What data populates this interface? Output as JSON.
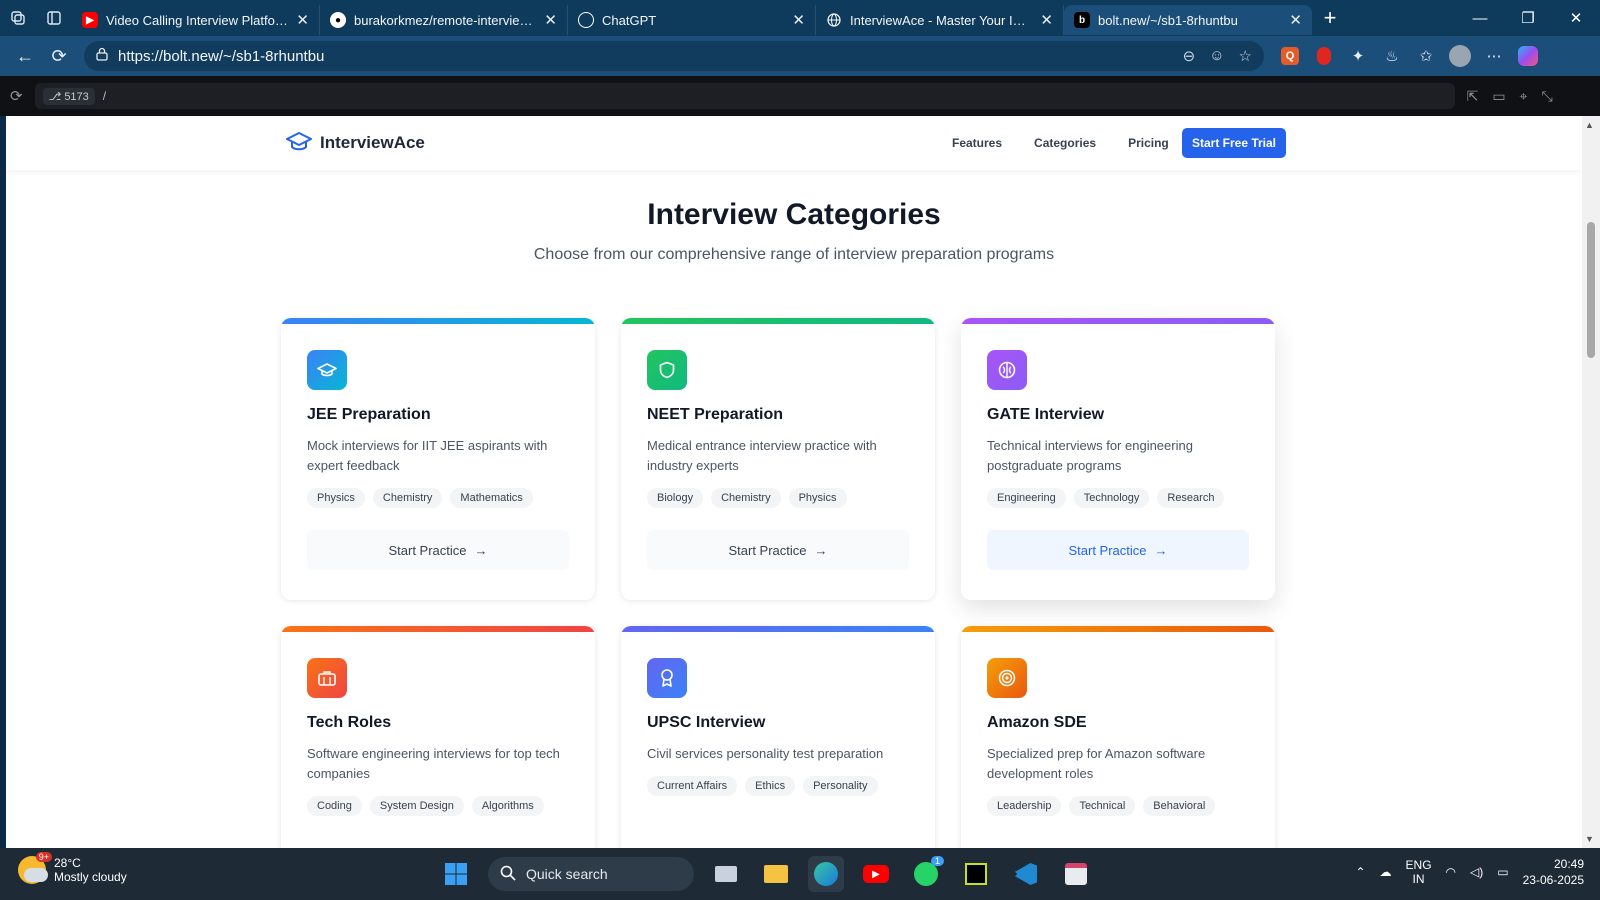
{
  "browser": {
    "tabs": [
      {
        "title": "Video Calling Interview Platform:",
        "favicon": "youtube-icon",
        "color": "#ff0000"
      },
      {
        "title": "burakorkmez/remote-interview-p",
        "favicon": "github-icon",
        "color": "#ffffff"
      },
      {
        "title": "ChatGPT",
        "favicon": "chatgpt-icon",
        "color": "#ffffff"
      },
      {
        "title": "InterviewAce - Master Your Interv",
        "favicon": "globe-icon",
        "color": "#ffffff"
      },
      {
        "title": "bolt.new/~/sb1-8rhuntbu",
        "favicon": "bolt-icon",
        "color": "#000000"
      }
    ],
    "url": "https://bolt.new/~/sb1-8rhuntbu",
    "dev_port": "5173",
    "dev_path": "/"
  },
  "site": {
    "brand": "InterviewAce",
    "nav": [
      "Features",
      "Categories",
      "Pricing"
    ],
    "cta": "Start Free Trial",
    "section_title": "Interview Categories",
    "section_subtitle": "Choose from our comprehensive range of interview preparation programs",
    "cards": [
      {
        "title": "JEE Preparation",
        "desc": "Mock interviews for IIT JEE aspirants with expert feedback",
        "tags": [
          "Physics",
          "Chemistry",
          "Mathematics"
        ],
        "action": "Start Practice",
        "icon": "graduation-cap-icon",
        "accent": "#3b82f6"
      },
      {
        "title": "NEET Preparation",
        "desc": "Medical entrance interview practice with industry experts",
        "tags": [
          "Biology",
          "Chemistry",
          "Physics"
        ],
        "action": "Start Practice",
        "icon": "shield-icon",
        "accent": "#22c55e"
      },
      {
        "title": "GATE Interview",
        "desc": "Technical interviews for engineering postgraduate programs",
        "tags": [
          "Engineering",
          "Technology",
          "Research"
        ],
        "action": "Start Practice",
        "icon": "brain-icon",
        "accent": "#a855f7"
      },
      {
        "title": "Tech Roles",
        "desc": "Software engineering interviews for top tech companies",
        "tags": [
          "Coding",
          "System Design",
          "Algorithms"
        ],
        "icon": "briefcase-icon",
        "accent": "#f97316"
      },
      {
        "title": "UPSC Interview",
        "desc": "Civil services personality test preparation",
        "tags": [
          "Current Affairs",
          "Ethics",
          "Personality"
        ],
        "icon": "award-icon",
        "accent": "#6366f1"
      },
      {
        "title": "Amazon SDE",
        "desc": "Specialized prep for Amazon software development roles",
        "tags": [
          "Leadership",
          "Technical",
          "Behavioral"
        ],
        "icon": "target-icon",
        "accent": "#ea580c"
      }
    ]
  },
  "taskbar": {
    "weather_temp": "28°C",
    "weather_desc": "Mostly cloudy",
    "weather_badge": "9+",
    "search_placeholder": "Quick search",
    "whatsapp_badge": "1",
    "lang_1": "ENG",
    "lang_2": "IN",
    "time": "20:49",
    "date": "23-06-2025"
  }
}
